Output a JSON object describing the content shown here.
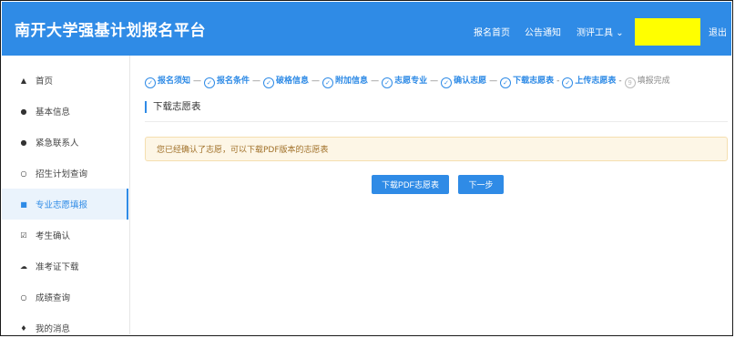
{
  "header": {
    "title": "南开大学强基计划报名平台",
    "nav": {
      "home": "报名首页",
      "notice": "公告通知",
      "tools": "测评工具",
      "logout": "退出"
    }
  },
  "sidebar": {
    "items": [
      {
        "label": "首页",
        "icon": "home-icon"
      },
      {
        "label": "基本信息",
        "icon": "user-icon"
      },
      {
        "label": "紧急联系人",
        "icon": "user-icon"
      },
      {
        "label": "招生计划查询",
        "icon": "search-icon"
      },
      {
        "label": "专业志愿填报",
        "icon": "form-icon",
        "active": true
      },
      {
        "label": "考生确认",
        "icon": "checkbox-icon"
      },
      {
        "label": "准考证下载",
        "icon": "cloud-download-icon"
      },
      {
        "label": "成绩查询",
        "icon": "search-icon"
      },
      {
        "label": "我的消息",
        "icon": "bell-icon"
      }
    ]
  },
  "steps": [
    {
      "label": "报名须知",
      "status": "done"
    },
    {
      "label": "报名条件",
      "status": "done"
    },
    {
      "label": "破格信息",
      "status": "done"
    },
    {
      "label": "附加信息",
      "status": "done"
    },
    {
      "label": "志愿专业",
      "status": "done"
    },
    {
      "label": "确认志愿",
      "status": "done"
    },
    {
      "label": "下载志愿表",
      "status": "done"
    },
    {
      "label": "上传志愿表",
      "status": "done"
    },
    {
      "label": "填报完成",
      "status": "pending",
      "number": "9"
    }
  ],
  "main": {
    "section_title": "下载志愿表",
    "alert": "您已经确认了志愿，可以下载PDF版本的志愿表",
    "download_button": "下载PDF志愿表",
    "next_button": "下一步"
  },
  "colors": {
    "primary": "#2f8be6",
    "alert_bg": "#fdf6e6",
    "alert_text": "#a07028",
    "redacted": "#ffff00"
  }
}
